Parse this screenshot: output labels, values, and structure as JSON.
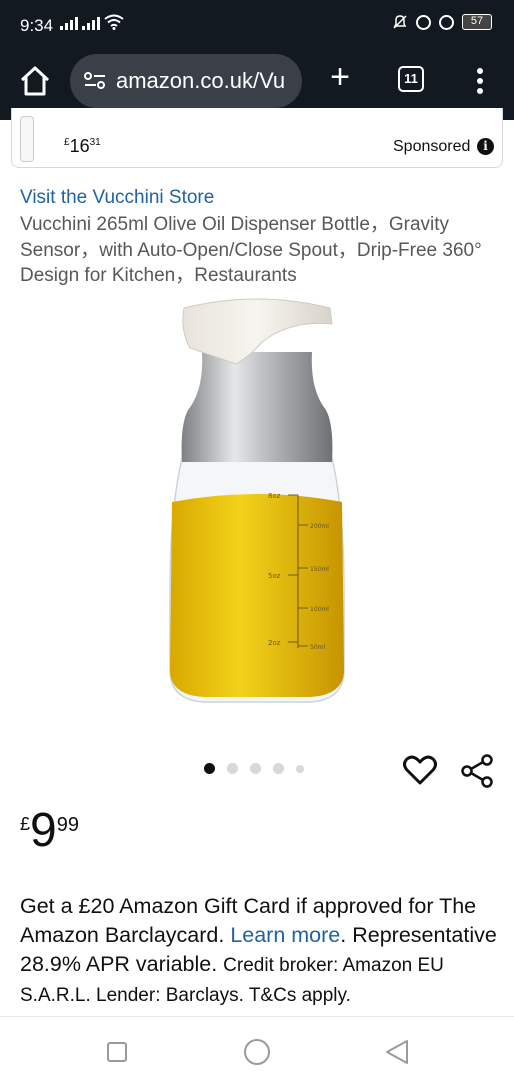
{
  "status_bar": {
    "time": "9:34",
    "battery": "57"
  },
  "browser": {
    "url": "amazon.co.uk/Vu",
    "tab_count": "11"
  },
  "sponsored_card": {
    "price_symbol": "£",
    "price_whole": "16",
    "price_fraction": "31",
    "label": "Sponsored"
  },
  "product": {
    "store_link": "Visit the Vucchini Store",
    "title": "Vucchini 265ml Olive Oil Dispenser Bottle，Gravity Sensor，with Auto-Open/Close Spout，Drip-Free 360° Design for Kitchen，Restaurants",
    "image_markings": {
      "oz_labels": [
        "8oz",
        "5oz",
        "2oz"
      ],
      "ml_labels": [
        "200ml",
        "150ml",
        "100ml",
        "50ml"
      ]
    },
    "image_count": 5,
    "active_image_index": 0
  },
  "price": {
    "symbol": "£",
    "whole": "9",
    "fraction": "99"
  },
  "offer": {
    "text_1": "Get a £20 Amazon Gift Card if approved for The Amazon Barclaycard. ",
    "link": "Learn more",
    "text_2": ". Representative 28.9% APR variable. ",
    "small_text": "Credit broker: Amazon EU S.A.R.L. Lender: Barclays. T&Cs apply."
  },
  "icons": {
    "home": "home-icon",
    "site_settings": "site-settings-icon",
    "new_tab": "plus-icon",
    "menu": "more-vertical-icon",
    "wishlist": "heart-icon",
    "share": "share-icon",
    "info": "info-icon"
  },
  "colors": {
    "header_bg": "#131921",
    "link": "#2162a1",
    "text": "#0f1111",
    "muted_text": "#565959"
  }
}
